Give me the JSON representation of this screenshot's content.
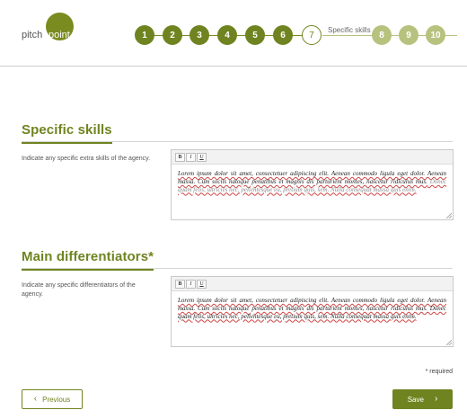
{
  "logo": {
    "part1": "pitch",
    "part2": "point"
  },
  "steps": [
    {
      "label": "1",
      "state": "done"
    },
    {
      "label": "2",
      "state": "done"
    },
    {
      "label": "3",
      "state": "done"
    },
    {
      "label": "4",
      "state": "done"
    },
    {
      "label": "5",
      "state": "done"
    },
    {
      "label": "6",
      "state": "done"
    },
    {
      "label": "7",
      "state": "current",
      "caption": "Specific skills"
    },
    {
      "label": "8",
      "state": "todo"
    },
    {
      "label": "9",
      "state": "todo"
    },
    {
      "label": "10",
      "state": "todo"
    }
  ],
  "sections": [
    {
      "title": "Specific skills",
      "description": "Indicate any specific extra skills of the agency.",
      "editor_text": "Lorem ipsum dolor sit amet, consectetuer adipiscing elit. Aenean commodo ligula eget dolor. Aenean massa. Cum sociis natoque penatibus et magnis dis parturient montes, nascetur ridiculus mus.",
      "editor_faded": " Donec quam felis, ultricies nec, pellentesque eu, pretium quis, sem. Nulla consequat massa quis enim."
    },
    {
      "title": "Main differentiators*",
      "description": "Indicate any specific differentiators of the agency.",
      "editor_text": "Lorem ipsum dolor sit amet, consectetuer adipiscing elit. Aenean commodo ligula eget dolor. Aenean massa. Cum sociis natoque penatibus et magnis dis parturient montes, nascetur ridiculus mus. Donec quam felis, ultricies nec, pellentesque eu, pretium quis, sem. Nulla consequat massa quis enim.",
      "editor_faded": ""
    }
  ],
  "toolbar": {
    "bold": "B",
    "italic": "I",
    "underline": "U"
  },
  "required_note": "* required",
  "buttons": {
    "previous": "Previous",
    "save": "Save"
  },
  "icons": {
    "prev": "chevron-left-icon",
    "next": "chevron-right-icon"
  },
  "colors": {
    "accent": "#6f8420",
    "todo": "#b8c27f"
  }
}
